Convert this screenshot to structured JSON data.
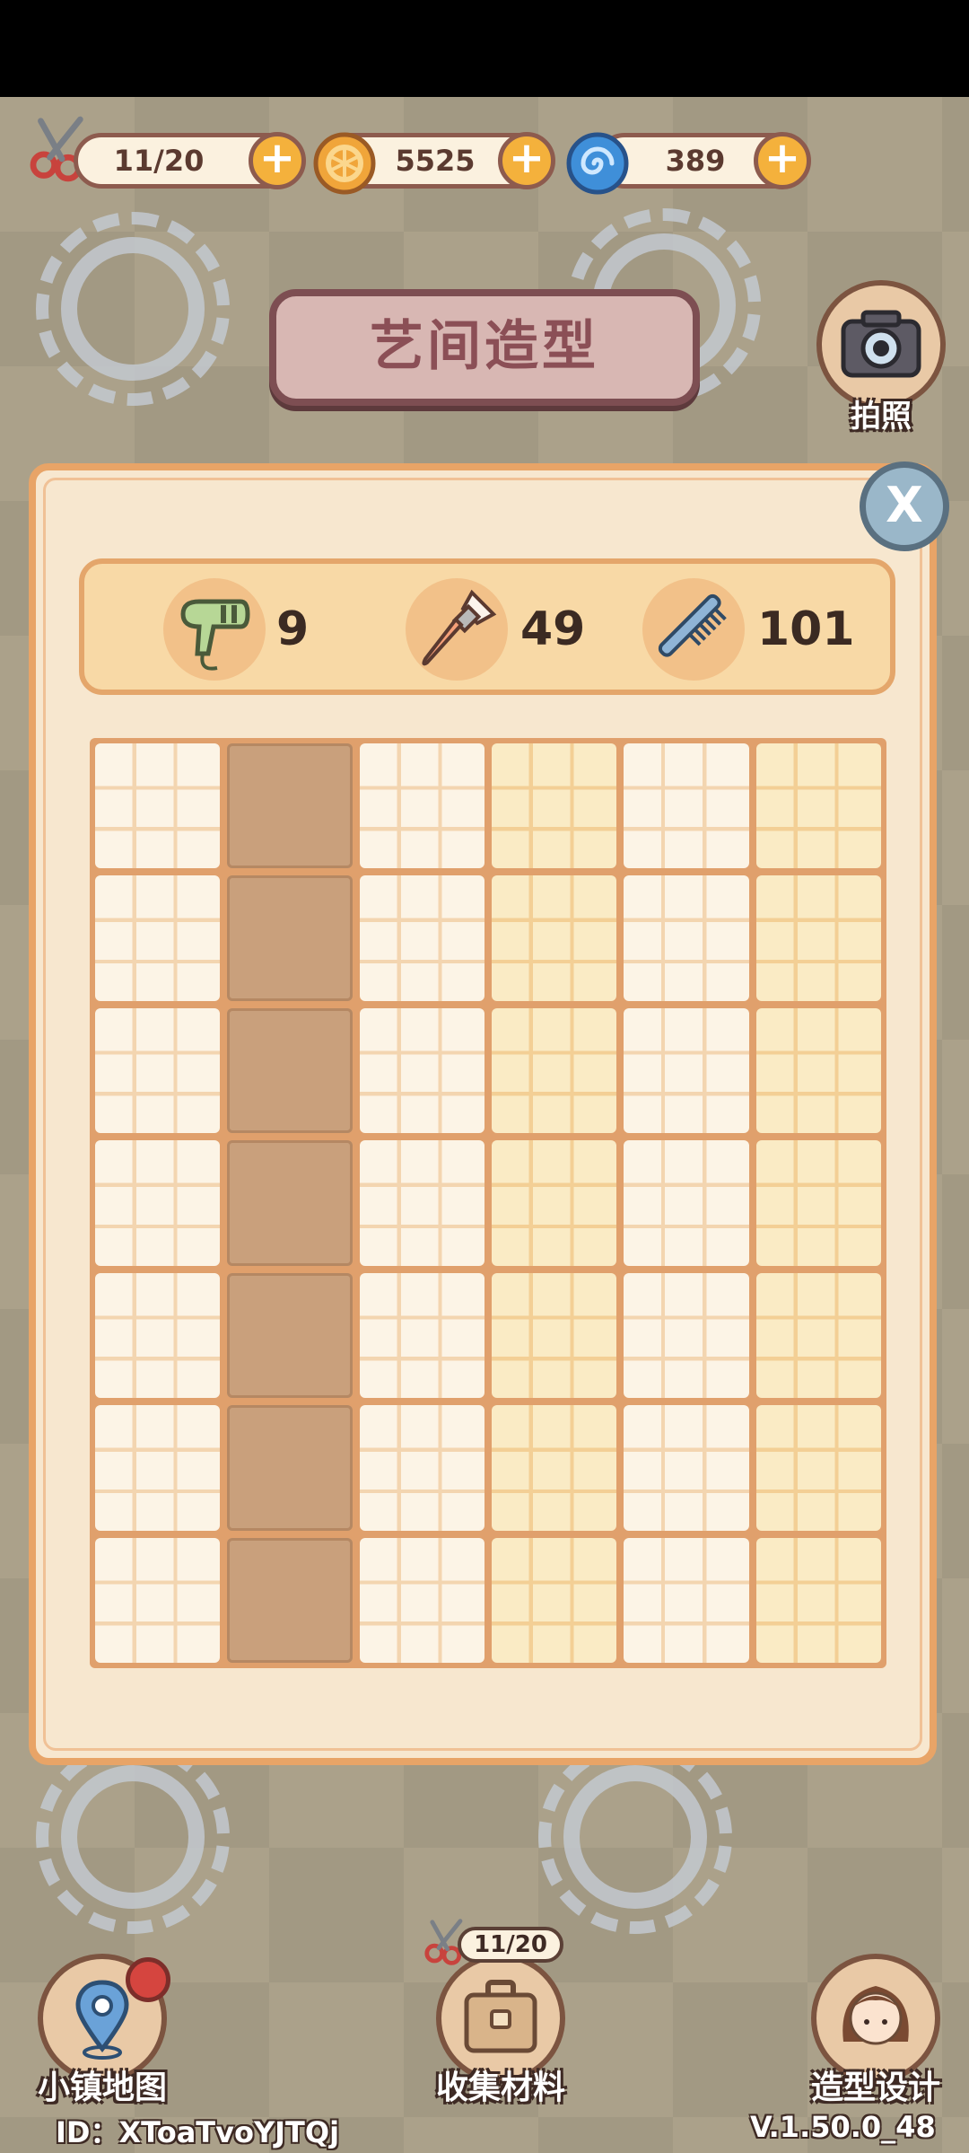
{
  "resources": {
    "scissors": {
      "value": "11/20",
      "icon": "scissors-icon"
    },
    "coins": {
      "value": "5525",
      "icon": "coin-icon"
    },
    "swirl": {
      "value": "389",
      "icon": "swirl-gem-icon"
    },
    "plus_label": "+"
  },
  "title": "艺间造型",
  "camera": {
    "label": "拍照",
    "icon": "camera-icon"
  },
  "close": {
    "label": "X",
    "icon": "close-icon"
  },
  "tools": [
    {
      "name": "hair-dryer",
      "icon": "hair-dryer-icon",
      "count": "9"
    },
    {
      "name": "makeup-brush",
      "icon": "makeup-brush-icon",
      "count": "49"
    },
    {
      "name": "comb",
      "icon": "comb-icon",
      "count": "101"
    }
  ],
  "grid": {
    "columns": 6,
    "rows": 7,
    "column_styles": [
      "light",
      "filled",
      "light",
      "yellow",
      "light",
      "yellow"
    ]
  },
  "nav": {
    "map": {
      "label": "小镇地图",
      "icon": "map-pin-icon"
    },
    "collect": {
      "label": "收集材料",
      "icon": "briefcase-icon",
      "counter": "11/20"
    },
    "design": {
      "label": "造型设计",
      "icon": "avatar-icon"
    }
  },
  "footer": {
    "id_text": "ID：XToaTvoYJTQj",
    "version": "V.1.50.0_48"
  },
  "colors": {
    "panel_border": "#e8a467",
    "panel_bg": "#f7e7cf",
    "filled_cell": "#c9a07c",
    "title_text": "#8b4f56",
    "plus_button": "#f4b13c"
  }
}
